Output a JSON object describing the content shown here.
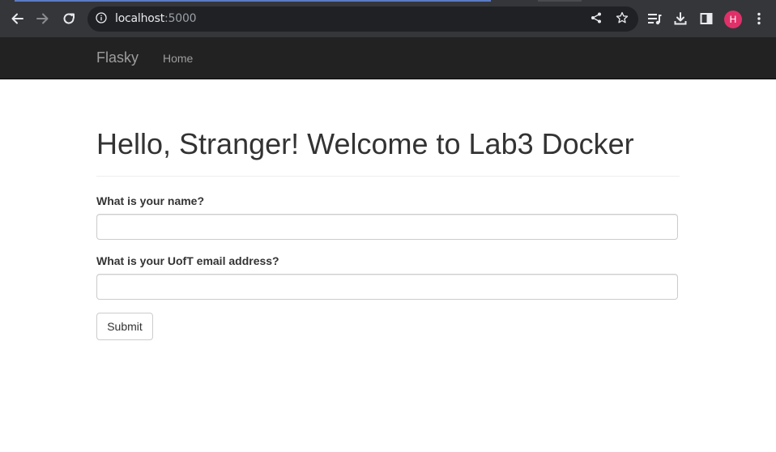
{
  "browser": {
    "url_host": "localhost",
    "url_port": ":5000",
    "avatar_initial": "H",
    "accent_color": "#e0306a",
    "icons": [
      "back-arrow-icon",
      "forward-arrow-icon",
      "reload-icon",
      "info-icon",
      "share-icon",
      "star-icon",
      "reading-list-icon",
      "download-icon",
      "side-panel-icon",
      "more-menu-icon"
    ]
  },
  "navbar": {
    "brand": "Flasky",
    "links": [
      "Home"
    ]
  },
  "main": {
    "title": "Hello, Stranger! Welcome to Lab3 Docker",
    "form": {
      "name_label": "What is your name?",
      "name_value": "",
      "email_label": "What is your UofT email address?",
      "email_value": "",
      "submit_label": "Submit"
    }
  }
}
